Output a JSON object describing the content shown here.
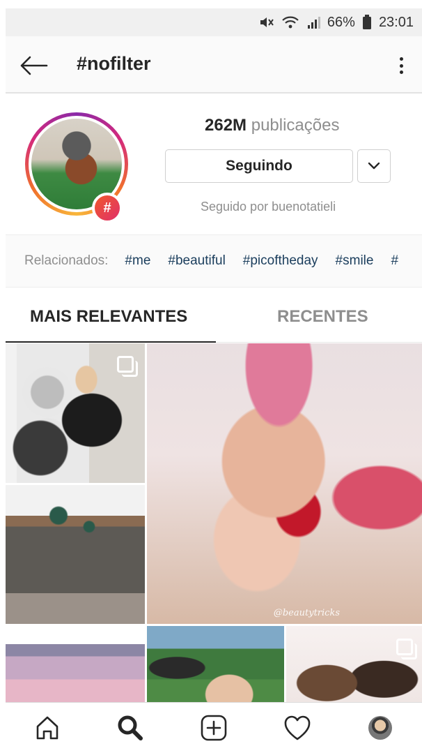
{
  "status_bar": {
    "battery": "66%",
    "time": "23:01",
    "icons": [
      "mute-icon",
      "wifi-icon",
      "signal-icon",
      "battery-icon"
    ]
  },
  "header": {
    "title": "#nofilter",
    "back_icon": "arrow-left-icon",
    "more_icon": "more-vertical-icon"
  },
  "profile": {
    "posts_count": "262M",
    "posts_label": "publicações",
    "follow_label": "Seguindo",
    "followed_by": "Seguido por buenotatieli",
    "badge": "#"
  },
  "related": {
    "label": "Relacionados:",
    "tags": [
      "#me",
      "#beautiful",
      "#picoftheday",
      "#smile",
      "#"
    ]
  },
  "tabs": {
    "top": "MAIS RELEVANTES",
    "recent": "RECENTES"
  },
  "grid": {
    "watermark": "@beautytricks"
  },
  "bottom_nav": {
    "items": [
      "home-icon",
      "search-icon",
      "add-post-icon",
      "heart-icon",
      "profile-avatar"
    ]
  }
}
